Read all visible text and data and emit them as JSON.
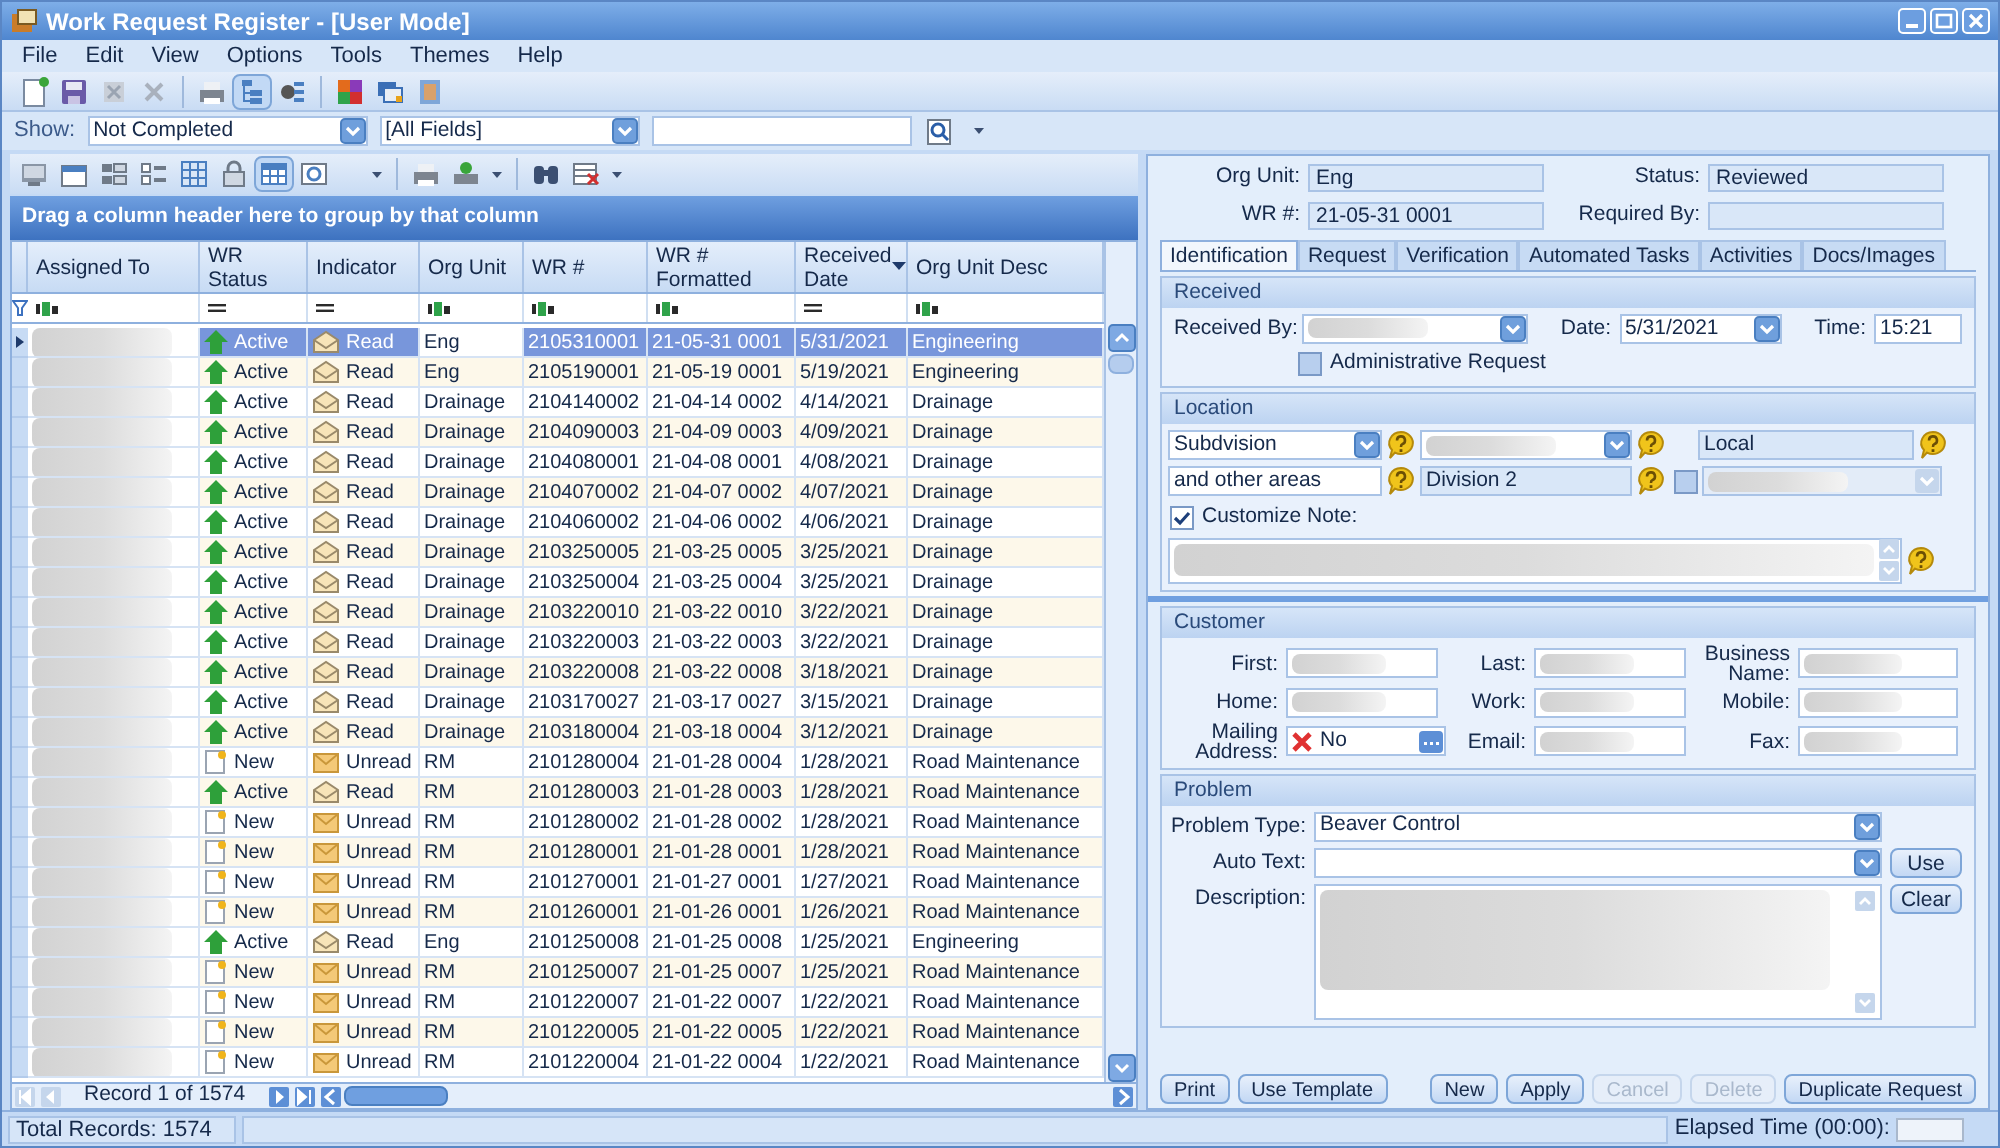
{
  "window": {
    "title": "Work Request Register - [User Mode]"
  },
  "menu": [
    "File",
    "Edit",
    "View",
    "Options",
    "Tools",
    "Themes",
    "Help"
  ],
  "show_bar": {
    "label": "Show:",
    "filter": "Not Completed",
    "field": "[All Fields]"
  },
  "grid": {
    "group_hint": "Drag a column header here to group by that column",
    "columns": [
      {
        "label": "Assigned To",
        "kind": "text",
        "sorted": false
      },
      {
        "label": "WR Status",
        "kind": "equals",
        "sorted": false
      },
      {
        "label": "Indicator",
        "kind": "equals",
        "sorted": false
      },
      {
        "label": "Org Unit",
        "kind": "text",
        "sorted": false
      },
      {
        "label": "WR #",
        "kind": "text",
        "sorted": false
      },
      {
        "label": "WR # Formatted",
        "kind": "text",
        "sorted": false
      },
      {
        "label": "Received Date",
        "kind": "equals",
        "sorted": true
      },
      {
        "label": "Org Unit Desc",
        "kind": "text",
        "sorted": false
      }
    ],
    "rows": [
      {
        "selected": true,
        "kind": "active",
        "status": "Active",
        "read": true,
        "indicator": "Read",
        "org_unit": "Eng",
        "wr": "2105310001",
        "wr_formatted": "21-05-31 0001",
        "date": "5/31/2021",
        "desc": "Engineering"
      },
      {
        "selected": false,
        "kind": "active",
        "status": "Active",
        "read": true,
        "indicator": "Read",
        "org_unit": "Eng",
        "wr": "2105190001",
        "wr_formatted": "21-05-19 0001",
        "date": "5/19/2021",
        "desc": "Engineering"
      },
      {
        "selected": false,
        "kind": "active",
        "status": "Active",
        "read": true,
        "indicator": "Read",
        "org_unit": "Drainage",
        "wr": "2104140002",
        "wr_formatted": "21-04-14 0002",
        "date": "4/14/2021",
        "desc": "Drainage"
      },
      {
        "selected": false,
        "kind": "active",
        "status": "Active",
        "read": true,
        "indicator": "Read",
        "org_unit": "Drainage",
        "wr": "2104090003",
        "wr_formatted": "21-04-09 0003",
        "date": "4/09/2021",
        "desc": "Drainage"
      },
      {
        "selected": false,
        "kind": "active",
        "status": "Active",
        "read": true,
        "indicator": "Read",
        "org_unit": "Drainage",
        "wr": "2104080001",
        "wr_formatted": "21-04-08 0001",
        "date": "4/08/2021",
        "desc": "Drainage"
      },
      {
        "selected": false,
        "kind": "active",
        "status": "Active",
        "read": true,
        "indicator": "Read",
        "org_unit": "Drainage",
        "wr": "2104070002",
        "wr_formatted": "21-04-07 0002",
        "date": "4/07/2021",
        "desc": "Drainage"
      },
      {
        "selected": false,
        "kind": "active",
        "status": "Active",
        "read": true,
        "indicator": "Read",
        "org_unit": "Drainage",
        "wr": "2104060002",
        "wr_formatted": "21-04-06 0002",
        "date": "4/06/2021",
        "desc": "Drainage"
      },
      {
        "selected": false,
        "kind": "active",
        "status": "Active",
        "read": true,
        "indicator": "Read",
        "org_unit": "Drainage",
        "wr": "2103250005",
        "wr_formatted": "21-03-25 0005",
        "date": "3/25/2021",
        "desc": "Drainage"
      },
      {
        "selected": false,
        "kind": "active",
        "status": "Active",
        "read": true,
        "indicator": "Read",
        "org_unit": "Drainage",
        "wr": "2103250004",
        "wr_formatted": "21-03-25 0004",
        "date": "3/25/2021",
        "desc": "Drainage"
      },
      {
        "selected": false,
        "kind": "active",
        "status": "Active",
        "read": true,
        "indicator": "Read",
        "org_unit": "Drainage",
        "wr": "2103220010",
        "wr_formatted": "21-03-22 0010",
        "date": "3/22/2021",
        "desc": "Drainage"
      },
      {
        "selected": false,
        "kind": "active",
        "status": "Active",
        "read": true,
        "indicator": "Read",
        "org_unit": "Drainage",
        "wr": "2103220003",
        "wr_formatted": "21-03-22 0003",
        "date": "3/22/2021",
        "desc": "Drainage"
      },
      {
        "selected": false,
        "kind": "active",
        "status": "Active",
        "read": true,
        "indicator": "Read",
        "org_unit": "Drainage",
        "wr": "2103220008",
        "wr_formatted": "21-03-22 0008",
        "date": "3/18/2021",
        "desc": "Drainage"
      },
      {
        "selected": false,
        "kind": "active",
        "status": "Active",
        "read": true,
        "indicator": "Read",
        "org_unit": "Drainage",
        "wr": "2103170027",
        "wr_formatted": "21-03-17 0027",
        "date": "3/15/2021",
        "desc": "Drainage"
      },
      {
        "selected": false,
        "kind": "active",
        "status": "Active",
        "read": true,
        "indicator": "Read",
        "org_unit": "Drainage",
        "wr": "2103180004",
        "wr_formatted": "21-03-18 0004",
        "date": "3/12/2021",
        "desc": "Drainage"
      },
      {
        "selected": false,
        "kind": "new",
        "status": "New",
        "read": false,
        "indicator": "Unread",
        "org_unit": "RM",
        "wr": "2101280004",
        "wr_formatted": "21-01-28 0004",
        "date": "1/28/2021",
        "desc": "Road Maintenance"
      },
      {
        "selected": false,
        "kind": "active",
        "status": "Active",
        "read": true,
        "indicator": "Read",
        "org_unit": "RM",
        "wr": "2101280003",
        "wr_formatted": "21-01-28 0003",
        "date": "1/28/2021",
        "desc": "Road Maintenance"
      },
      {
        "selected": false,
        "kind": "new",
        "status": "New",
        "read": false,
        "indicator": "Unread",
        "org_unit": "RM",
        "wr": "2101280002",
        "wr_formatted": "21-01-28 0002",
        "date": "1/28/2021",
        "desc": "Road Maintenance"
      },
      {
        "selected": false,
        "kind": "new",
        "status": "New",
        "read": false,
        "indicator": "Unread",
        "org_unit": "RM",
        "wr": "2101280001",
        "wr_formatted": "21-01-28 0001",
        "date": "1/28/2021",
        "desc": "Road Maintenance"
      },
      {
        "selected": false,
        "kind": "new",
        "status": "New",
        "read": false,
        "indicator": "Unread",
        "org_unit": "RM",
        "wr": "2101270001",
        "wr_formatted": "21-01-27 0001",
        "date": "1/27/2021",
        "desc": "Road Maintenance"
      },
      {
        "selected": false,
        "kind": "new",
        "status": "New",
        "read": false,
        "indicator": "Unread",
        "org_unit": "RM",
        "wr": "2101260001",
        "wr_formatted": "21-01-26 0001",
        "date": "1/26/2021",
        "desc": "Road Maintenance"
      },
      {
        "selected": false,
        "kind": "active",
        "status": "Active",
        "read": true,
        "indicator": "Read",
        "org_unit": "Eng",
        "wr": "2101250008",
        "wr_formatted": "21-01-25 0008",
        "date": "1/25/2021",
        "desc": "Engineering"
      },
      {
        "selected": false,
        "kind": "new",
        "status": "New",
        "read": false,
        "indicator": "Unread",
        "org_unit": "RM",
        "wr": "2101250007",
        "wr_formatted": "21-01-25 0007",
        "date": "1/25/2021",
        "desc": "Road Maintenance"
      },
      {
        "selected": false,
        "kind": "new",
        "status": "New",
        "read": false,
        "indicator": "Unread",
        "org_unit": "RM",
        "wr": "2101220007",
        "wr_formatted": "21-01-22 0007",
        "date": "1/22/2021",
        "desc": "Road Maintenance"
      },
      {
        "selected": false,
        "kind": "new",
        "status": "New",
        "read": false,
        "indicator": "Unread",
        "org_unit": "RM",
        "wr": "2101220005",
        "wr_formatted": "21-01-22 0005",
        "date": "1/22/2021",
        "desc": "Road Maintenance"
      },
      {
        "selected": false,
        "kind": "new",
        "status": "New",
        "read": false,
        "indicator": "Unread",
        "org_unit": "RM",
        "wr": "2101220004",
        "wr_formatted": "21-01-22 0004",
        "date": "1/22/2021",
        "desc": "Road Maintenance"
      }
    ],
    "record_nav": "Record 1 of 1574"
  },
  "detail": {
    "header_fields": [
      {
        "label": "Org Unit:",
        "value": "Eng"
      },
      {
        "label": "Status:",
        "value": "Reviewed"
      },
      {
        "label": "WR #:",
        "value": "21-05-31 0001"
      },
      {
        "label": "Required By:"
      }
    ],
    "tabs": [
      {
        "label": "Identification",
        "selected": true
      },
      {
        "label": "Request",
        "selected": false
      },
      {
        "label": "Verification",
        "selected": false
      },
      {
        "label": "Automated Tasks",
        "selected": false
      },
      {
        "label": "Activities",
        "selected": false
      },
      {
        "label": "Docs/Images",
        "selected": false
      }
    ],
    "received": {
      "title": "Received",
      "received_by_label": "Received By:",
      "date_label": "Date:",
      "date": "5/31/2021",
      "time_label": "Time:",
      "time": "15:21",
      "admin_label": "Administrative Request",
      "admin_checked": false
    },
    "location": {
      "title": "Location",
      "area_type": "Subdvision",
      "local": "Local",
      "area_note": "and other areas",
      "division": "Division 2",
      "extra_checked": false,
      "note_label": "Customize Note:",
      "note_checked": true
    },
    "customer": {
      "title": "Customer",
      "labels": [
        "First:",
        "Last:",
        "Business Name:",
        "Home:",
        "Work:",
        "Mobile:",
        "Mailing Address:",
        "Email:",
        "Fax:"
      ],
      "mailing": "No"
    },
    "problem": {
      "title": "Problem",
      "type_label": "Problem Type:",
      "type": "Beaver Control",
      "auto_label": "Auto Text:",
      "use": "Use",
      "desc_label": "Description:",
      "clear": "Clear"
    },
    "left_buttons": [
      {
        "label": "Print",
        "disabled": false
      },
      {
        "label": "Use Template",
        "disabled": false
      }
    ],
    "right_buttons": [
      {
        "label": "New",
        "disabled": false
      },
      {
        "label": "Apply",
        "disabled": false
      },
      {
        "label": "Cancel",
        "disabled": true
      },
      {
        "label": "Delete",
        "disabled": true
      },
      {
        "label": "Duplicate Request",
        "disabled": false
      }
    ]
  },
  "status_bar": {
    "total": "Total Records: 1574",
    "elapsed": "Elapsed Time (00:00):"
  }
}
